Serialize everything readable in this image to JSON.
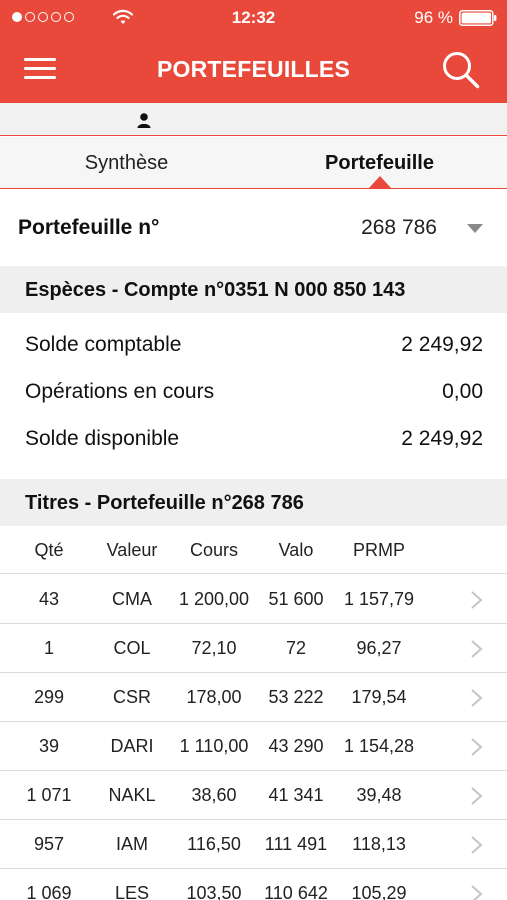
{
  "status_bar": {
    "time": "12:32",
    "battery": "96 %",
    "signal_icon": "signal-dots-icon",
    "wifi_icon": "wifi-icon",
    "battery_icon": "battery-icon"
  },
  "header": {
    "title": "PORTEFEUILLES",
    "menu_icon": "hamburger-menu-icon",
    "search_icon": "search-icon",
    "color": "#e8493a"
  },
  "user": {
    "icon": "user-icon"
  },
  "tabs": [
    {
      "label": "Synthèse",
      "active": false
    },
    {
      "label": "Portefeuille",
      "active": true
    }
  ],
  "selector": {
    "label": "Portefeuille n°",
    "value": "268 786"
  },
  "especes": {
    "title": "Espèces - Compte n°0351 N 000 850 143",
    "rows": [
      {
        "label": "Solde comptable",
        "value": "2 249,92"
      },
      {
        "label": "Opérations en cours",
        "value": "0,00"
      },
      {
        "label": "Solde disponible",
        "value": "2 249,92"
      }
    ]
  },
  "titres": {
    "title": "Titres - Portefeuille n°268 786",
    "columns": {
      "qte": "Qté",
      "valeur": "Valeur",
      "cours": "Cours",
      "valo": "Valo",
      "prmp": "PRMP"
    },
    "rows": [
      {
        "qte": "43",
        "valeur": "CMA",
        "cours": "1 200,00",
        "valo": "51 600",
        "prmp": "1 157,79"
      },
      {
        "qte": "1",
        "valeur": "COL",
        "cours": "72,10",
        "valo": "72",
        "prmp": "96,27"
      },
      {
        "qte": "299",
        "valeur": "CSR",
        "cours": "178,00",
        "valo": "53 222",
        "prmp": "179,54"
      },
      {
        "qte": "39",
        "valeur": "DARI",
        "cours": "1 110,00",
        "valo": "43 290",
        "prmp": "1 154,28"
      },
      {
        "qte": "1 071",
        "valeur": "NAKL",
        "cours": "38,60",
        "valo": "41 341",
        "prmp": "39,48"
      },
      {
        "qte": "957",
        "valeur": "IAM",
        "cours": "116,50",
        "valo": "111 491",
        "prmp": "118,13"
      },
      {
        "qte": "1 069",
        "valeur": "LES",
        "cours": "103,50",
        "valo": "110 642",
        "prmp": "105,29"
      }
    ]
  }
}
